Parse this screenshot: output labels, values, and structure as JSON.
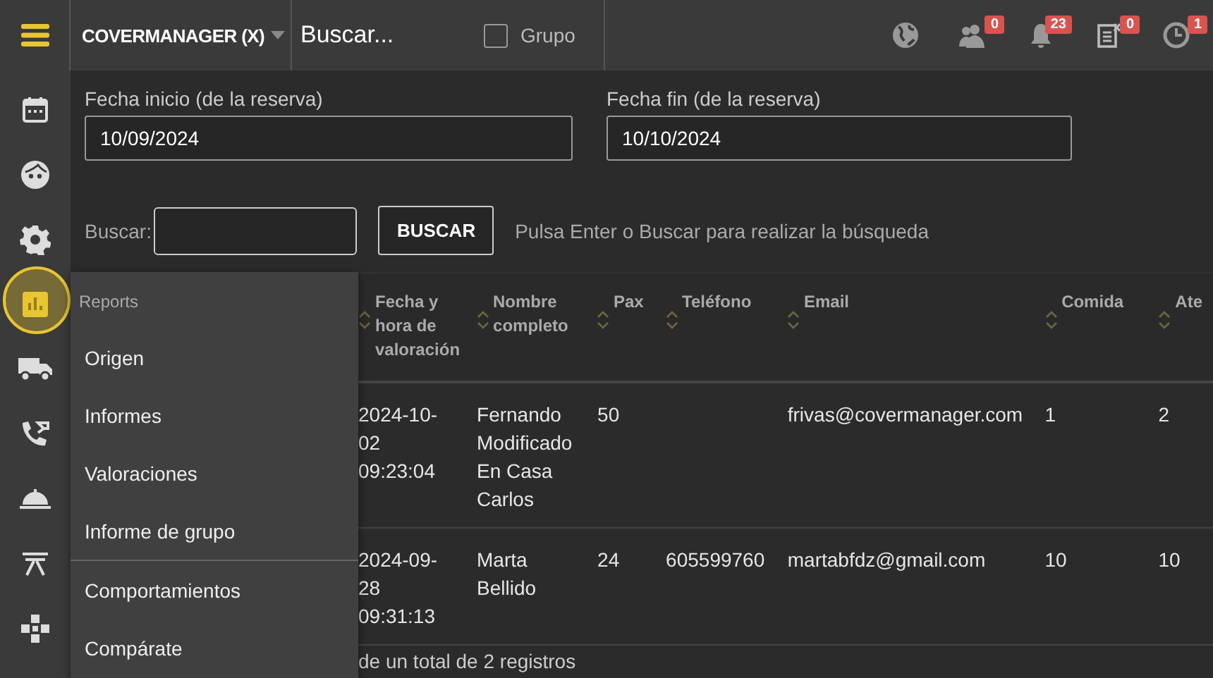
{
  "topbar": {
    "account": "COVERMANAGER (X)",
    "search_placeholder": "Buscar...",
    "group_checkbox": {
      "label": "Grupo",
      "checked": false
    },
    "icons": [
      {
        "kind": "globe"
      },
      {
        "kind": "people",
        "badge": "0"
      },
      {
        "kind": "bell",
        "badge": "23"
      },
      {
        "kind": "clipboard",
        "badge": "0"
      },
      {
        "kind": "clock",
        "badge": "1"
      }
    ]
  },
  "sidebar": {
    "items": [
      {
        "kind": "calendar",
        "selected": false
      },
      {
        "kind": "face",
        "selected": false
      },
      {
        "kind": "gear",
        "selected": false
      },
      {
        "kind": "chart",
        "selected": true
      },
      {
        "kind": "truck",
        "selected": false
      },
      {
        "kind": "phone",
        "selected": false
      },
      {
        "kind": "cloche",
        "selected": false
      },
      {
        "kind": "table",
        "selected": false
      },
      {
        "kind": "puzzle",
        "selected": false
      }
    ]
  },
  "filters": {
    "start": {
      "label": "Fecha inicio (de la reserva)",
      "value": "10/09/2024"
    },
    "end": {
      "label": "Fecha fin (de la reserva)",
      "value": "10/10/2024"
    },
    "search_label": "Buscar:",
    "search_button": "BUSCAR",
    "hint": "Pulsa Enter o Buscar para realizar la búsqueda"
  },
  "table": {
    "columns": [
      "Fecha y hora de valoración",
      "Nombre completo",
      "Pax",
      "Teléfono",
      "Email",
      "Comida",
      "Ate"
    ],
    "rows": [
      [
        "2024-10-02 09:23:04",
        "Fernando Modificado En Casa Carlos",
        "50",
        "",
        "frivas@covermanager.com",
        "1",
        "2"
      ],
      [
        "2024-09-28 09:31:13",
        "Marta Bellido",
        "24",
        "605599760",
        "martabfdz@gmail.com",
        "10",
        "10"
      ]
    ],
    "footer": "de un total de 2 registros"
  },
  "menu": {
    "title": "Reports",
    "groups": [
      [
        "Origen",
        "Informes",
        "Valoraciones",
        "Informe de grupo"
      ],
      [
        "Comportamientos",
        "Compárate"
      ]
    ]
  }
}
